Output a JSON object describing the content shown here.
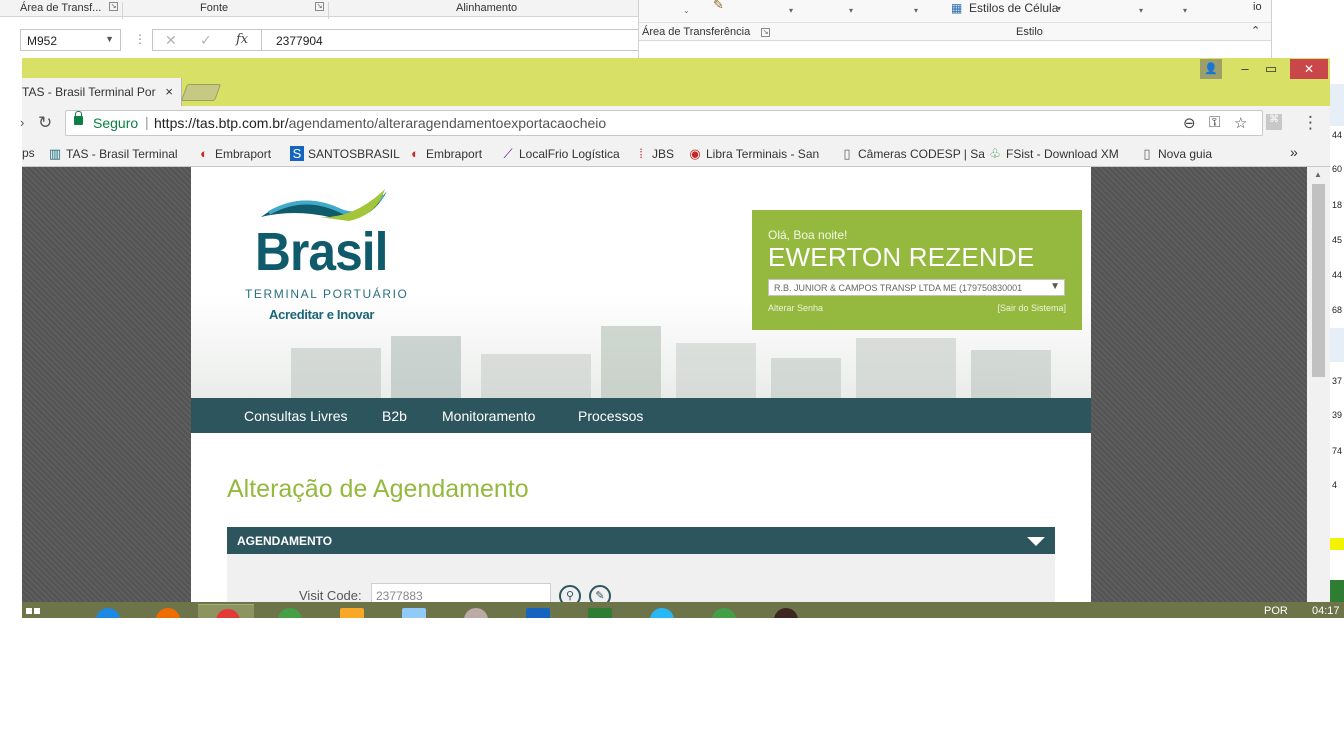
{
  "excel": {
    "groups": [
      "Área de Transf...",
      "Fonte",
      "Alinhamento"
    ],
    "name_box": "M952",
    "formula_value": "2377904",
    "fx_label": "fx",
    "ribbon_right": {
      "area_label": "Área de Transferência",
      "styles_label": "Estilos de Célula",
      "style_group": "Estilo",
      "trailing": "io"
    },
    "right_numbers": [
      "44",
      "60",
      "18",
      "45",
      "44",
      "68",
      "37",
      "39",
      "74",
      "4"
    ]
  },
  "browser": {
    "tab_title": "TAS - Brasil Terminal Por",
    "tab_close": "×",
    "secure_label": "Seguro",
    "url_host": "https://tas.btp.com.br/",
    "url_path": "agendamento/alteraragendamentoexportacaocheio",
    "bookmarks": [
      {
        "label": "ps",
        "icon": ""
      },
      {
        "label": "TAS - Brasil Terminal",
        "icon": "tas-icon"
      },
      {
        "label": "Embraport",
        "icon": "embraport-icon"
      },
      {
        "label": "SANTOSBRASIL",
        "icon": "santosbrasil-icon"
      },
      {
        "label": "Embraport",
        "icon": "embraport-icon"
      },
      {
        "label": "LocalFrio Logística",
        "icon": "localfrio-icon"
      },
      {
        "label": "JBS",
        "icon": "jbs-icon"
      },
      {
        "label": "Libra Terminais - San",
        "icon": "libra-icon"
      },
      {
        "label": "Câmeras CODESP | Sa",
        "icon": "page-icon"
      },
      {
        "label": "FSist - Download XM",
        "icon": "fsist-icon"
      },
      {
        "label": "Nova guia",
        "icon": "page-icon"
      }
    ],
    "bookmarks_more": "»",
    "colors": {
      "frame": "#d9e066",
      "close": "#c9474a",
      "secure": "#0b8043"
    }
  },
  "site": {
    "logo": {
      "brand": "Brasil",
      "subtitle": "TERMINAL PORTUÁRIO",
      "tagline": "Acreditar e Inovar"
    },
    "user": {
      "greeting": "Olá, Boa noite!",
      "name": "EWERTON REZENDE",
      "company": "R.B. JUNIOR & CAMPOS TRANSP LTDA ME (179750830001",
      "change_password": "Alterar Senha",
      "logout": "[Sair do Sistema]"
    },
    "nav": [
      "Consultas Livres",
      "B2b",
      "Monitoramento",
      "Processos"
    ],
    "page_title": "Alteração de Agendamento",
    "section_title": "AGENDAMENTO",
    "visit_code_label": "Visit Code:",
    "visit_code_value": "2377883",
    "colors": {
      "accent": "#95b93f",
      "nav": "#2d555e",
      "brand": "#0f5a6b"
    }
  },
  "taskbar": {
    "language": "POR",
    "time": "04:17"
  }
}
